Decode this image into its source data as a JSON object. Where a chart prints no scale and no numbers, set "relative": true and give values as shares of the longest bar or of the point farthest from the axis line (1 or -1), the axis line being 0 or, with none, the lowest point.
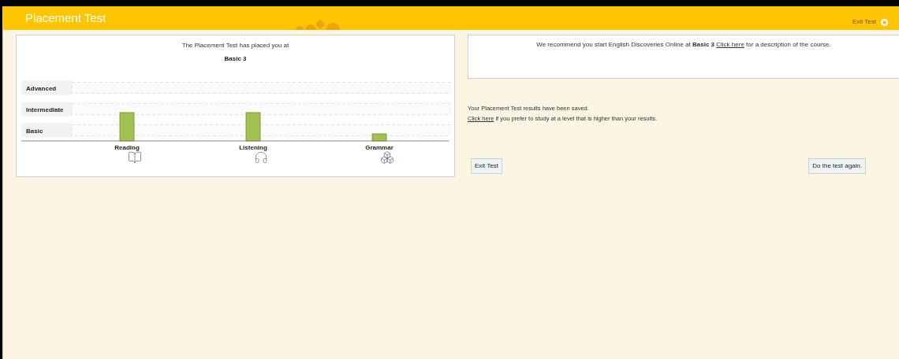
{
  "header": {
    "title": "Placement Test",
    "exit_link": "Exit Test"
  },
  "result_card": {
    "intro": "The Placement Test has placed you at",
    "level": "Basic 3",
    "levels": [
      "Advanced",
      "Intermediate",
      "Basic"
    ],
    "chart_data": {
      "type": "bar",
      "relative": true,
      "categories": [
        "Reading",
        "Listening",
        "Grammar"
      ],
      "values": [
        1,
        1,
        0.25
      ]
    },
    "skill_icons": [
      {
        "kind": "book"
      },
      {
        "kind": "headphones"
      },
      {
        "kind": "cubes"
      }
    ]
  },
  "recommendation": {
    "text": "We recommend you start English Discoveries Online at **Basic 3**",
    "link": "Click here",
    "after": "for a description of the course."
  },
  "saved_message": "Your Placement Test results have been saved.",
  "higher_level": {
    "link": "Click here",
    "text": "if you prefer to study at a level that is higher than your results."
  },
  "buttons": [
    {
      "label": "Exit Test"
    },
    {
      "label": "Do the test again."
    }
  ]
}
